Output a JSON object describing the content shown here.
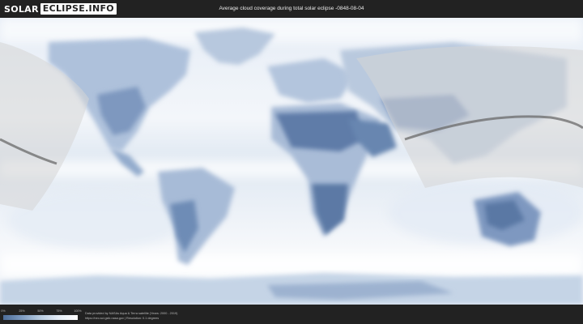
{
  "logo": {
    "part1": "SOLAR",
    "part2": "ECLIPSE.INFO"
  },
  "header": {
    "title": "Average cloud coverage during total solar eclipse -0848-08-04"
  },
  "legend": {
    "ticks": [
      "0%",
      "25%",
      "50%",
      "75%",
      "100%"
    ]
  },
  "credits": {
    "line1": "Data provided by NASAs Aqua & Terra satellite (Years: 2000 - 2019)",
    "line2": "https://neo.sci.gsfc.nasa.gov | Resolution: 0.1 degrees"
  },
  "colors": {
    "ocean": "#eef3f9",
    "clear_land": "#5d7ba6",
    "cloud": "#ffffff",
    "eclipse_path": "#666666",
    "shade": "#d4d4d4"
  }
}
